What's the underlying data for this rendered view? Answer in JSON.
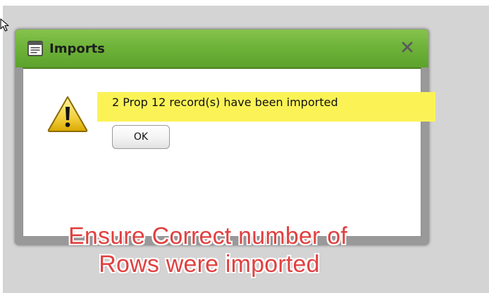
{
  "dialog": {
    "title": "Imports",
    "title_icon": "window-icon",
    "close_icon": "close-icon",
    "message": "2 Prop 12 record(s) have been imported",
    "warning_icon": "warning-icon",
    "ok_label": "OK"
  },
  "annotation": {
    "line1": "Ensure Correct number of",
    "line2": "Rows were imported"
  },
  "colors": {
    "titlebar_green": "#6fb33a",
    "highlight_yellow": "#fbf356",
    "annotation_red": "#e14040",
    "backdrop_gray": "#d4d4d4"
  },
  "icons": {
    "cursor": "mouse-pointer-icon"
  }
}
